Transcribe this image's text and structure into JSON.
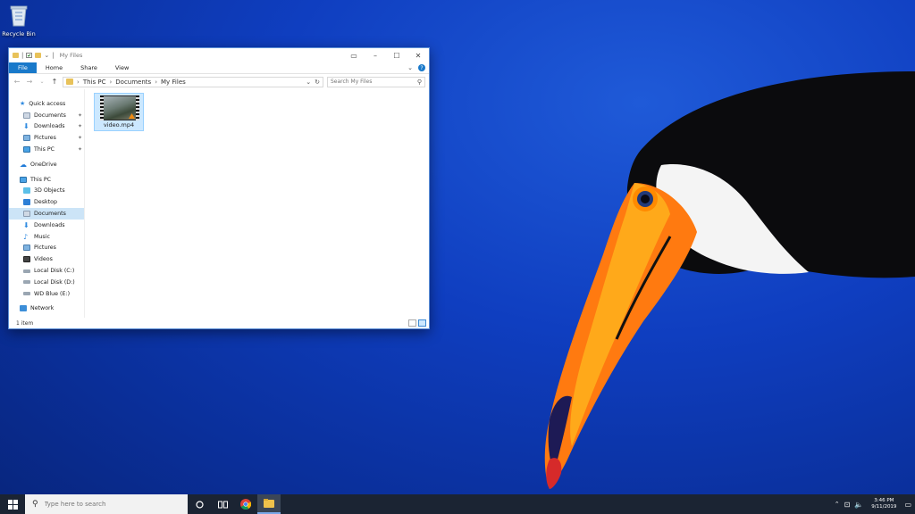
{
  "desktop": {
    "recycle_bin_label": "Recycle Bin"
  },
  "window": {
    "title": "My Files",
    "ribbon_tabs": [
      "File",
      "Home",
      "Share",
      "View"
    ],
    "address": {
      "segments": [
        "This PC",
        "Documents",
        "My Files"
      ]
    },
    "search_placeholder": "Search My Files",
    "nav_pane": {
      "quick_access": "Quick access",
      "quick_items": [
        "Documents",
        "Downloads",
        "Pictures",
        "This PC"
      ],
      "onedrive": "OneDrive",
      "this_pc": "This PC",
      "pc_items": [
        "3D Objects",
        "Desktop",
        "Documents",
        "Downloads",
        "Music",
        "Pictures",
        "Videos",
        "Local Disk (C:)",
        "Local Disk (D:)",
        "WD Blue (E:)"
      ],
      "network": "Network",
      "selected": "Documents"
    },
    "files": [
      {
        "name": "video.mp4"
      }
    ],
    "status": "1 item"
  },
  "taskbar": {
    "search_placeholder": "Type here to search",
    "time": "3:46 PM",
    "date": "9/11/2019"
  },
  "colors": {
    "accent": "#1979ca",
    "selection": "#cce4f7",
    "taskbar": "#1b2433"
  }
}
